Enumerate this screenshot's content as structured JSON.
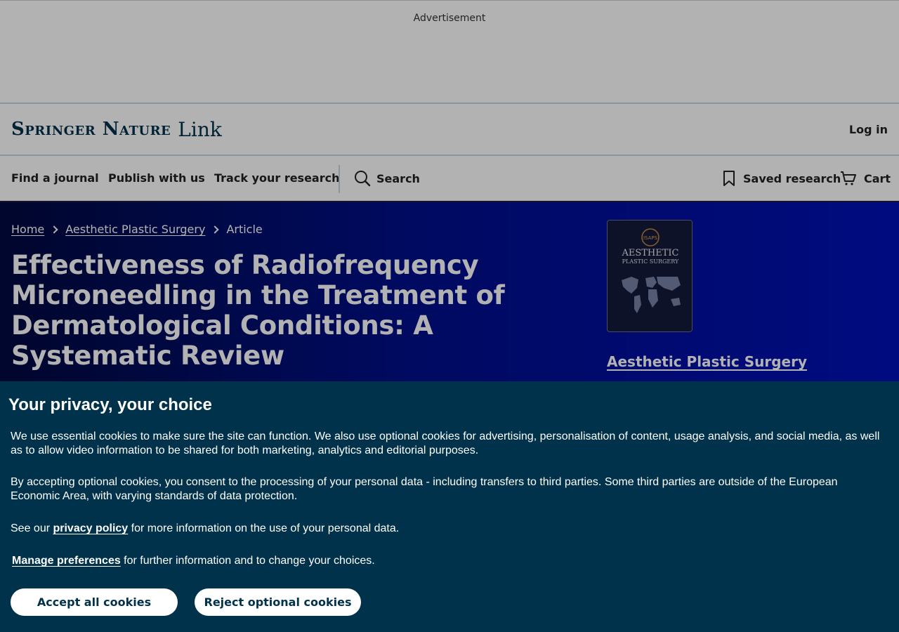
{
  "ad": {
    "label": "Advertisement"
  },
  "header": {
    "logo_main": "Springer Nature",
    "logo_link": "Link",
    "login": "Log in"
  },
  "nav": {
    "find_journal": "Find a journal",
    "publish": "Publish with us",
    "track": "Track your research",
    "search": "Search",
    "saved": "Saved research",
    "cart": "Cart"
  },
  "breadcrumb": {
    "home": "Home",
    "journal": "Aesthetic Plastic Surgery",
    "current": "Article"
  },
  "article": {
    "title": "Effectiveness of Radiofrequency Microneedling in the Treatment of Dermatological Conditions: A Systematic Review",
    "journal_link": "Aesthetic Plastic Surgery"
  },
  "cover": {
    "society": "ISAPS",
    "title_line1": "AESTHETIC",
    "title_line2": "PLASTIC SURGERY"
  },
  "cookie": {
    "heading": "Your privacy, your choice",
    "para1": "We use essential cookies to make sure the site can function. We also use optional cookies for advertising, personalisation of content, usage analysis, and social media, as well as to allow video information to be shared for both marketing, analytics and editorial purposes.",
    "para2": "By accepting optional cookies, you consent to the processing of your personal data - including transfers to third parties. Some third parties are outside of the European Economic Area, with varying standards of data protection.",
    "para3_before": "See our ",
    "para3_link": "privacy policy",
    "para3_after": " for more information on the use of your personal data.",
    "para4_link": "Manage preferences",
    "para4_after": " for further information and to change your choices.",
    "accept": "Accept all cookies",
    "reject": "Reject optional cookies"
  }
}
